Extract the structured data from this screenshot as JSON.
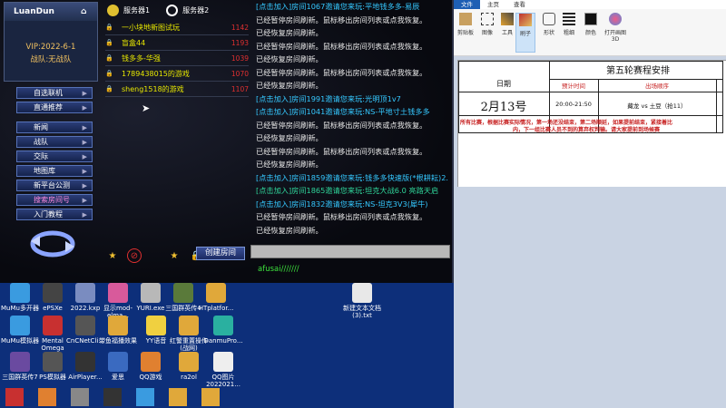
{
  "lobby": {
    "logo": "LuanDun",
    "vip": "VIP:2022-6-1",
    "clan": "战队:无战队",
    "menu": [
      {
        "label": "自选联机",
        "has_arrow": true
      },
      {
        "label": "直通推荐",
        "has_arrow": true
      },
      {
        "label": "新闻",
        "has_arrow": true
      },
      {
        "label": "战队",
        "has_arrow": true
      },
      {
        "label": "交际",
        "has_arrow": true
      },
      {
        "label": "地图库",
        "has_arrow": true
      },
      {
        "label": "新平台公测",
        "has_arrow": true
      },
      {
        "label": "搜索房间号",
        "has_arrow": true
      },
      {
        "label": "入门教程",
        "has_arrow": true
      }
    ],
    "servers": [
      {
        "label": "服务器1",
        "icon": "coin-icon"
      },
      {
        "label": "服务器2",
        "icon": "globe-icon"
      }
    ],
    "rooms": [
      {
        "name": "一小块地新图试玩",
        "count": "1142"
      },
      {
        "name": "盲盒44",
        "count": "1193"
      },
      {
        "name": "钱多多-华强",
        "count": "1039"
      },
      {
        "name": "1789438015的游戏",
        "count": "1070"
      },
      {
        "name": "sheng1518的游戏",
        "count": "1107"
      }
    ],
    "create_room": "创建房间",
    "user_message": "afusai///////",
    "chat": [
      {
        "text": "[点击加入]房间1067邀请您来玩:平地钱多多-易辰",
        "kind": "inv"
      },
      {
        "text": "已经暂停房间刷新。鼠标移出房间列表或点我恢复。",
        "kind": "sys"
      },
      {
        "text": "已经恢复房间刷新。",
        "kind": "sys"
      },
      {
        "text": "已经暂停房间刷新。鼠标移出房间列表或点我恢复。",
        "kind": "sys"
      },
      {
        "text": "已经恢复房间刷新。",
        "kind": "sys"
      },
      {
        "text": "已经暂停房间刷新。鼠标移出房间列表或点我恢复。",
        "kind": "sys"
      },
      {
        "text": "已经恢复房间刷新。",
        "kind": "sys"
      },
      {
        "text": "[点击加入]房间1991邀请您来玩:光明顶1v7",
        "kind": "inv"
      },
      {
        "text": "[点击加入]房间1041邀请您来玩:NS-平地寸土钱多多",
        "kind": "inv"
      },
      {
        "text": "已经暂停房间刷新。鼠标移出房间列表或点我恢复。",
        "kind": "sys"
      },
      {
        "text": "已经恢复房间刷新。",
        "kind": "sys"
      },
      {
        "text": "已经暂停房间刷新。鼠标移出房间列表或点我恢复。",
        "kind": "sys"
      },
      {
        "text": "已经恢复房间刷新。",
        "kind": "sys"
      },
      {
        "text": "[点击加入]房间1859邀请您来玩:钱多多快速版(*根耕耘)2.",
        "kind": "inv"
      },
      {
        "text": "[点击加入]房间1865邀请您来玩:坦克大战6.0 亮路天启",
        "kind": "inv2"
      },
      {
        "text": "[点击加入]房间1832邀请您来玩:NS-坦克3V3(犀牛)",
        "kind": "inv"
      },
      {
        "text": "已经暂停房间刷新。鼠标移出房间列表或点我恢复。",
        "kind": "sys"
      },
      {
        "text": "已经恢复房间刷新。",
        "kind": "sys"
      }
    ]
  },
  "desktop": [
    {
      "label": "MuMu多开器",
      "color": "#3a9be0"
    },
    {
      "label": "ePSXe",
      "color": "#444"
    },
    {
      "label": "2022.kxp",
      "color": "#7a8cc0"
    },
    {
      "label": "显示mod-elma...",
      "color": "#d85a9b"
    },
    {
      "label": "YURI.exe",
      "color": "#b8b8b8"
    },
    {
      "label": "三国群英传4",
      "color": "#5a7a3a"
    },
    {
      "label": "HTplatfor...",
      "color": "#e0a83a"
    },
    {
      "label": "新建文本文档(3).txt",
      "color": "#e8e8e8"
    },
    {
      "label": "MuMu模拟器",
      "color": "#3a9be0"
    },
    {
      "label": "Mental Omega",
      "color": "#c83030"
    },
    {
      "label": "CnCNetCli...",
      "color": "#555"
    },
    {
      "label": "带鱼福播效果",
      "color": "#e0a83a"
    },
    {
      "label": "YY语音",
      "color": "#f0d040"
    },
    {
      "label": "红警重置操作(战网)",
      "color": "#e0a83a"
    },
    {
      "label": "DanmuPro...",
      "color": "#2ab0a0"
    },
    {
      "label": "三国群英传7",
      "color": "#6a4aa0"
    },
    {
      "label": "PS模拟器",
      "color": "#555"
    },
    {
      "label": "AirPlayer...",
      "color": "#333"
    },
    {
      "label": "爱思",
      "color": "#3a6ac0"
    },
    {
      "label": "QQ游戏",
      "color": "#e08030"
    },
    {
      "label": "ra2ol",
      "color": "#e0a83a"
    },
    {
      "label": "QQ图片2022021...",
      "color": "#eee"
    }
  ],
  "paint": {
    "tabs": [
      "文件",
      "主页",
      "查看"
    ],
    "ribbon": [
      "剪贴板",
      "图像",
      "工具",
      "刷子",
      "形状",
      "粗细",
      "颜色",
      "打开画图 3D"
    ],
    "sheet": {
      "title": "第五轮赛程安排",
      "col_date": "日期",
      "col_time": "预计时间",
      "col_order": "出场顺序",
      "date_value": "2月13号",
      "time_value": "20:00-21:50",
      "match_value": "藏龙 vs 土豆（抢11）",
      "note_line1": "所有比赛，根据比赛实际情况，第一场还没结束，第二场顺延，如果提前结束，紧接着比",
      "note_line2": "内，下一组比赛人员不到的算弃权判输。请大家提前到场候赛"
    }
  }
}
